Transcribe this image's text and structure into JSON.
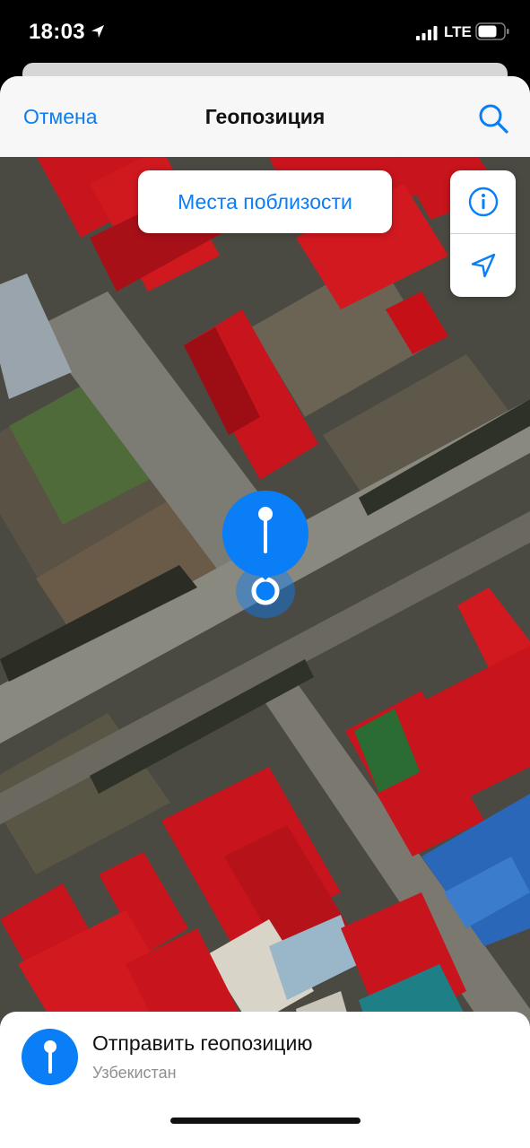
{
  "status_bar": {
    "time": "18:03",
    "network": "LTE",
    "icons": [
      "location-arrow-icon",
      "signal-icon",
      "battery-icon"
    ]
  },
  "nav": {
    "cancel_label": "Отмена",
    "title": "Геопозиция",
    "search_icon": "search-icon"
  },
  "map": {
    "style": "satellite",
    "nearby_label": "Места поблизости",
    "controls": [
      "info-icon",
      "location-arrow-icon"
    ],
    "pin_icon": "map-pin-icon"
  },
  "send_location": {
    "title": "Отправить геопозицию",
    "subtitle": "Узбекистан",
    "icon": "map-pin-icon"
  },
  "colors": {
    "accent": "#0a7ef7",
    "roof_red": "#c8141c",
    "roof_blue": "#2a67b8",
    "roof_teal": "#1e7f86"
  }
}
